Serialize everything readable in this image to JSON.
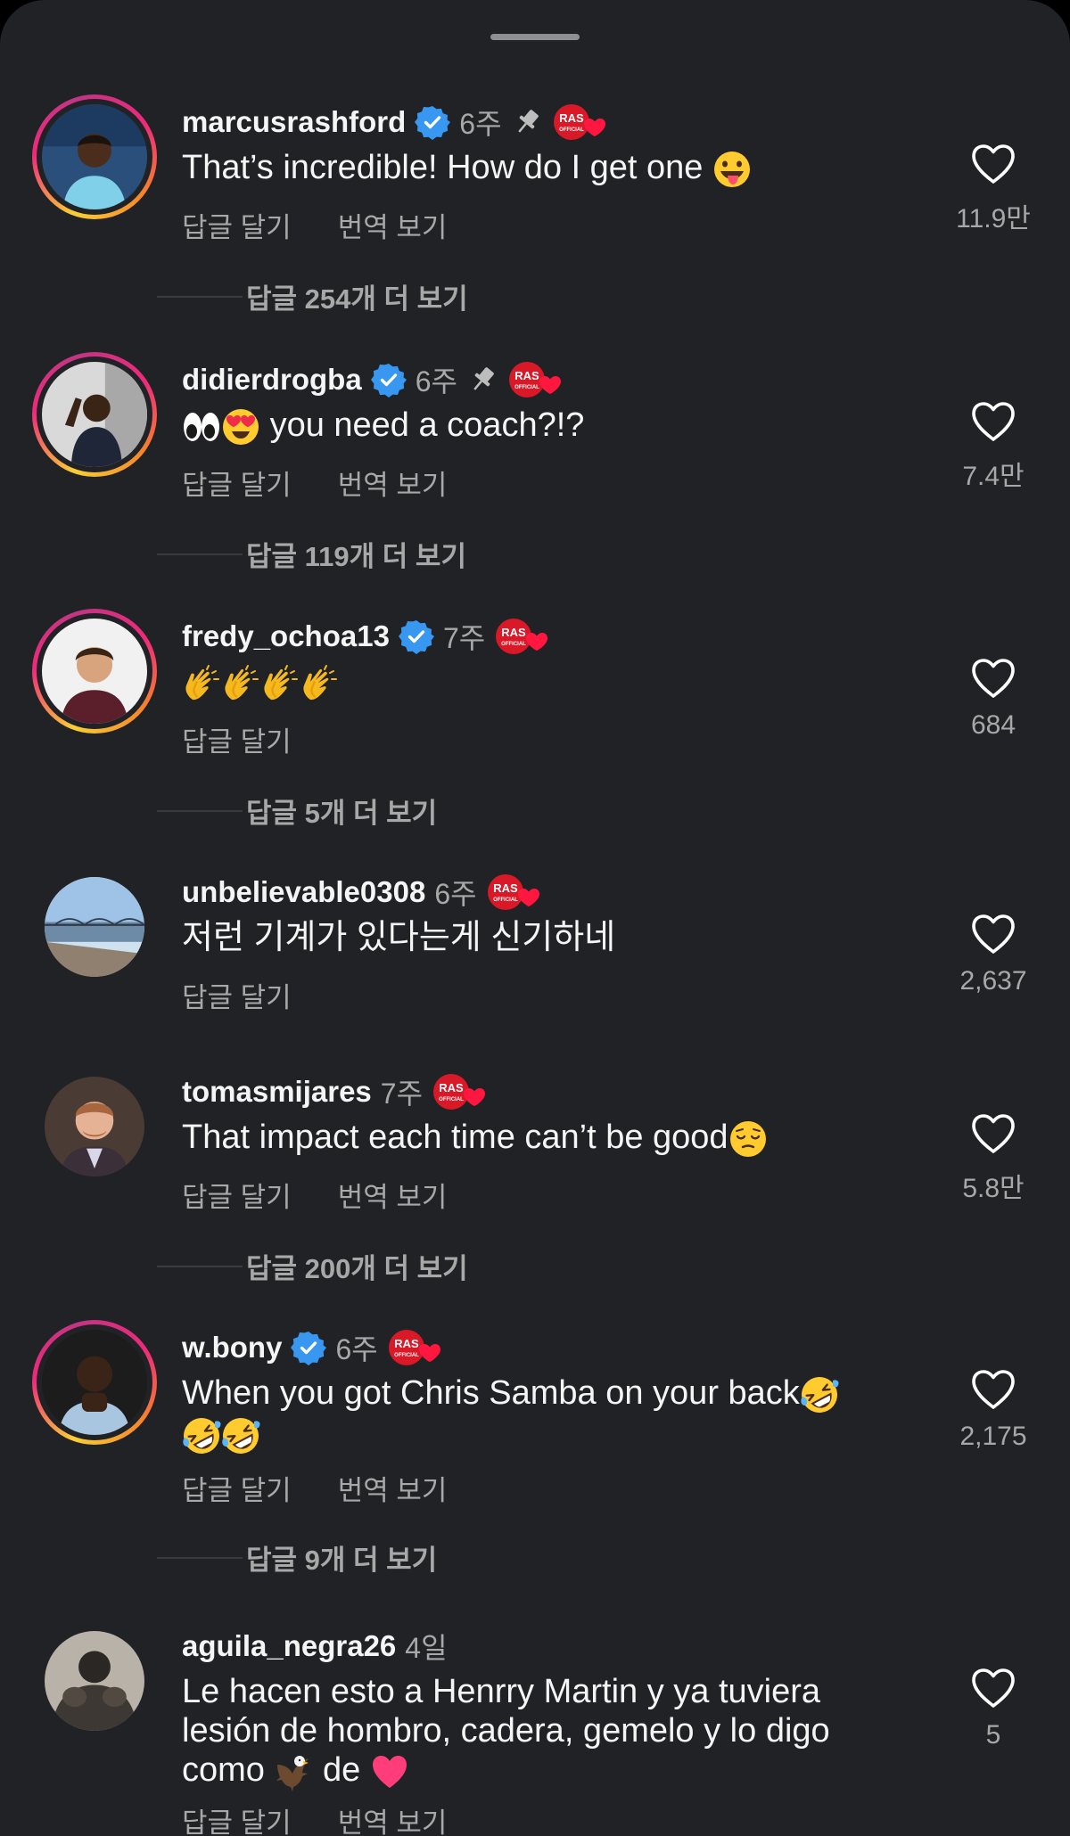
{
  "colors": {
    "background": "#212226",
    "text": "#f5f5f5",
    "muted": "#a8a8a8",
    "verified": "#3897f0",
    "like_heart": "#ffffff"
  },
  "comments": [
    {
      "username": "marcusrashford",
      "time": "6주",
      "verified": true,
      "pinned": true,
      "text": "That’s incredible! How do I get one ",
      "emoji": "tongue-out-emoji",
      "reply_label": "답글 달기",
      "translate_label": "번역 보기",
      "likes": "11.9만",
      "more_replies": "답글 254개 더 보기"
    },
    {
      "username": "didierdrogba",
      "time": "6주",
      "verified": true,
      "pinned": true,
      "text": "you need a coach?!?",
      "emoji": "eyes-heart-eyes-emoji",
      "reply_label": "답글 달기",
      "translate_label": "번역 보기",
      "likes": "7.4만",
      "more_replies": "답글 119개 더 보기"
    },
    {
      "username": "fredy_ochoa13",
      "time": "7주",
      "verified": true,
      "pinned": false,
      "text": "",
      "emoji": "clapping-hands-emoji-x4",
      "reply_label": "답글 달기",
      "likes": "684",
      "more_replies": "답글 5개 더 보기"
    },
    {
      "username": "unbelievable0308",
      "time": "6주",
      "verified": false,
      "pinned": false,
      "text": "저런 기계가 있다는게 신기하네",
      "reply_label": "답글 달기",
      "likes": "2,637"
    },
    {
      "username": "tomasmijares",
      "time": "7주",
      "verified": false,
      "pinned": false,
      "text": "That impact each time can’t be good",
      "emoji": "relieved-face-emoji",
      "reply_label": "답글 달기",
      "translate_label": "번역 보기",
      "likes": "5.8만",
      "more_replies": "답글 200개 더 보기"
    },
    {
      "username": "w.bony",
      "time": "6주",
      "verified": true,
      "pinned": false,
      "text": "When you got Chris Samba on your back",
      "emoji": "rofl-emoji-x3",
      "reply_label": "답글 달기",
      "translate_label": "번역 보기",
      "likes": "2,175",
      "more_replies": "답글 9개 더 보기"
    },
    {
      "username": "aguila_negra26",
      "time": "4일",
      "verified": false,
      "pinned": false,
      "text_line1": "Le hacen esto a Henrry Martin y ya tuviera",
      "text_line2": "lesión de hombro, cadera, gemelo y lo digo",
      "text_line3a": "como ",
      "text_line3b": " de ",
      "emoji": "eagle-and-heart-emoji",
      "reply_label": "답글 달기",
      "translate_label": "번역 보기",
      "likes": "5"
    }
  ]
}
